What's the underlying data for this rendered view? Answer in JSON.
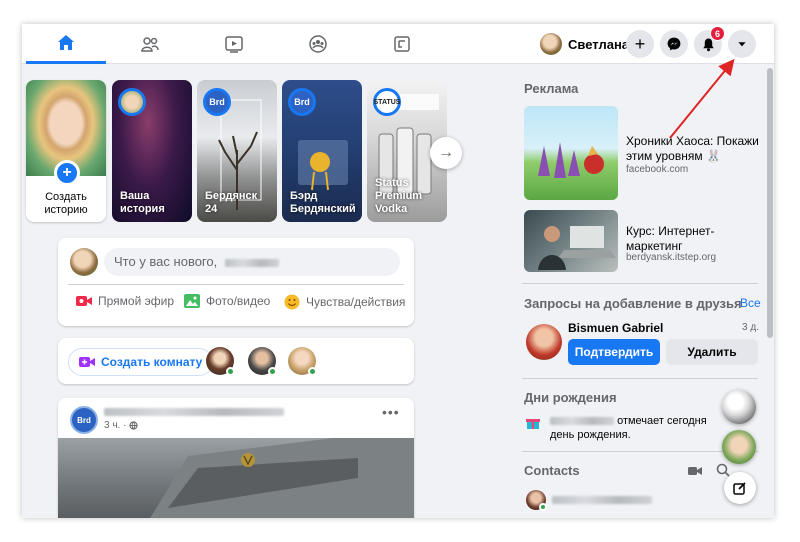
{
  "header": {
    "profile_name": "Светлана",
    "notifications_count": "6"
  },
  "stories": {
    "create_label": "Создать историю",
    "items": [
      {
        "label": "Ваша история",
        "avatar": ""
      },
      {
        "label": "Бердянск 24",
        "avatar": "Brd"
      },
      {
        "label": "Бэрд Бердянский",
        "avatar": "Brd"
      },
      {
        "label": "Status Premium Vodka",
        "avatar": "STATUS"
      }
    ]
  },
  "composer": {
    "placeholder": "Что у вас нового,",
    "actions": [
      {
        "label": "Прямой эфир",
        "color": "#f02849"
      },
      {
        "label": "Фото/видео",
        "color": "#45bd62"
      },
      {
        "label": "Чувства/действия",
        "color": "#f7b928"
      }
    ]
  },
  "rooms": {
    "create_room_label": "Создать комнату"
  },
  "post": {
    "avatar": "Brd",
    "meta": "3 ч. ·"
  },
  "sidebar": {
    "ads_heading": "Реклама",
    "ads": [
      {
        "title": "Хроники Хаоса: Покажи этим уровням 🐰",
        "site": "facebook.com"
      },
      {
        "title": "Курс: Интернет-маркетинг",
        "site": "berdyansk.itstep.org"
      }
    ],
    "friend_requests_heading": "Запросы на добавление в друзья",
    "see_all": "Все",
    "request": {
      "name": "Bismuen Gabriel",
      "time": "3 д.",
      "confirm": "Подтвердить",
      "delete": "Удалить"
    },
    "birthdays_heading": "Дни рождения",
    "birthday_text": "отмечает сегодня день рождения.",
    "contacts_heading": "Contacts"
  },
  "colors": {
    "brand": "#1877f2",
    "badge": "#e41e3f",
    "online": "#31a24c"
  }
}
